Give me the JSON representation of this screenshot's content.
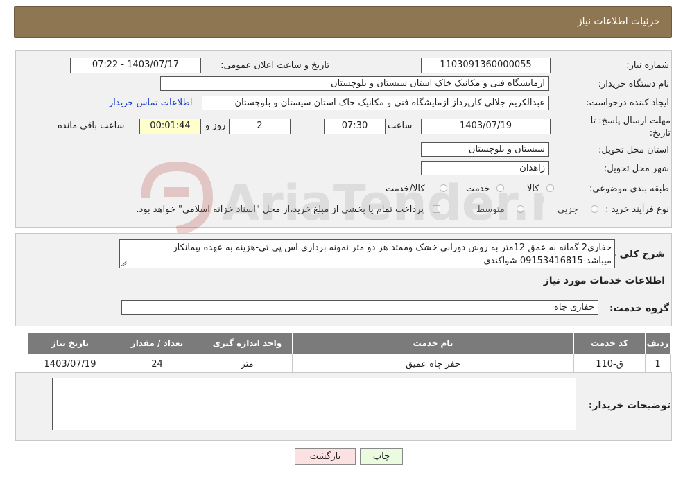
{
  "header": {
    "title": "جزئیات اطلاعات نیاز"
  },
  "info": {
    "need_number_label": "شماره نیاز:",
    "need_number": "1103091360000055",
    "announce_label": "تاریخ و ساعت اعلان عمومی:",
    "announce_value": "1403/07/17 - 07:22",
    "buyer_label": "نام دستگاه خریدار:",
    "buyer": "ازمایشگاه فنی و مکانیک خاک استان سیستان و بلوچستان",
    "creator_label": "ایجاد کننده درخواست:",
    "creator": "عبدالکریم جلالی کارپرداز ازمایشگاه فنی و مکانیک خاک استان سیستان و بلوچستان",
    "contact_link": "اطلاعات تماس خریدار",
    "deadline_label": "مهلت ارسال پاسخ: تا تاریخ:",
    "deadline_date": "1403/07/19",
    "time_label": "ساعت",
    "deadline_time": "07:30",
    "days_value": "2",
    "days_label": "روز و",
    "remaining_value": "00:01:44",
    "remaining_label": "ساعت باقی مانده",
    "province_label": "استان محل تحویل:",
    "province": "سیستان و بلوچستان",
    "city_label": "شهر محل تحویل:",
    "city": "زاهدان",
    "category_label": "طبقه بندی موضوعی:",
    "category_options": [
      "کالا",
      "خدمت",
      "کالا/خدمت"
    ],
    "process_label": "نوع فرآیند خرید :",
    "process_options": [
      "جزیی",
      "متوسط"
    ],
    "payment_note": "پرداخت تمام یا بخشی از مبلغ خرید،از محل \"اسناد خزانه اسلامی\" خواهد بود."
  },
  "description": {
    "label": "شرح کلی نیاز:",
    "text": "حفاری2 گمانه به عمق 12متر به روش دورانی خشک وممتد هر دو متر نمونه برداری اس پی تی-هزینه به عهده پیمانکار میباشد-09153416815 شواکندی"
  },
  "services": {
    "section_title": "اطلاعات خدمات مورد نیاز",
    "group_label": "گروه خدمت:",
    "group_value": "حفاری چاه",
    "columns": [
      "ردیف",
      "کد خدمت",
      "نام خدمت",
      "واحد اندازه گیری",
      "تعداد / مقدار",
      "تاریخ نیاز"
    ],
    "rows": [
      {
        "row": "1",
        "code": "ق-110",
        "name": "حفر چاه عمیق",
        "unit": "متر",
        "qty": "24",
        "date": "1403/07/19"
      }
    ]
  },
  "buyer_notes": {
    "label": "توضیحات خریدار:",
    "value": ""
  },
  "buttons": {
    "print": "چاپ",
    "back": "بازگشت"
  },
  "watermark_text": "AriaTender.neT",
  "colors": {
    "header": "#8e7653",
    "table_header": "#7b7b7b",
    "timer_bg": "#ffffcc",
    "link": "#1a3cc9"
  }
}
